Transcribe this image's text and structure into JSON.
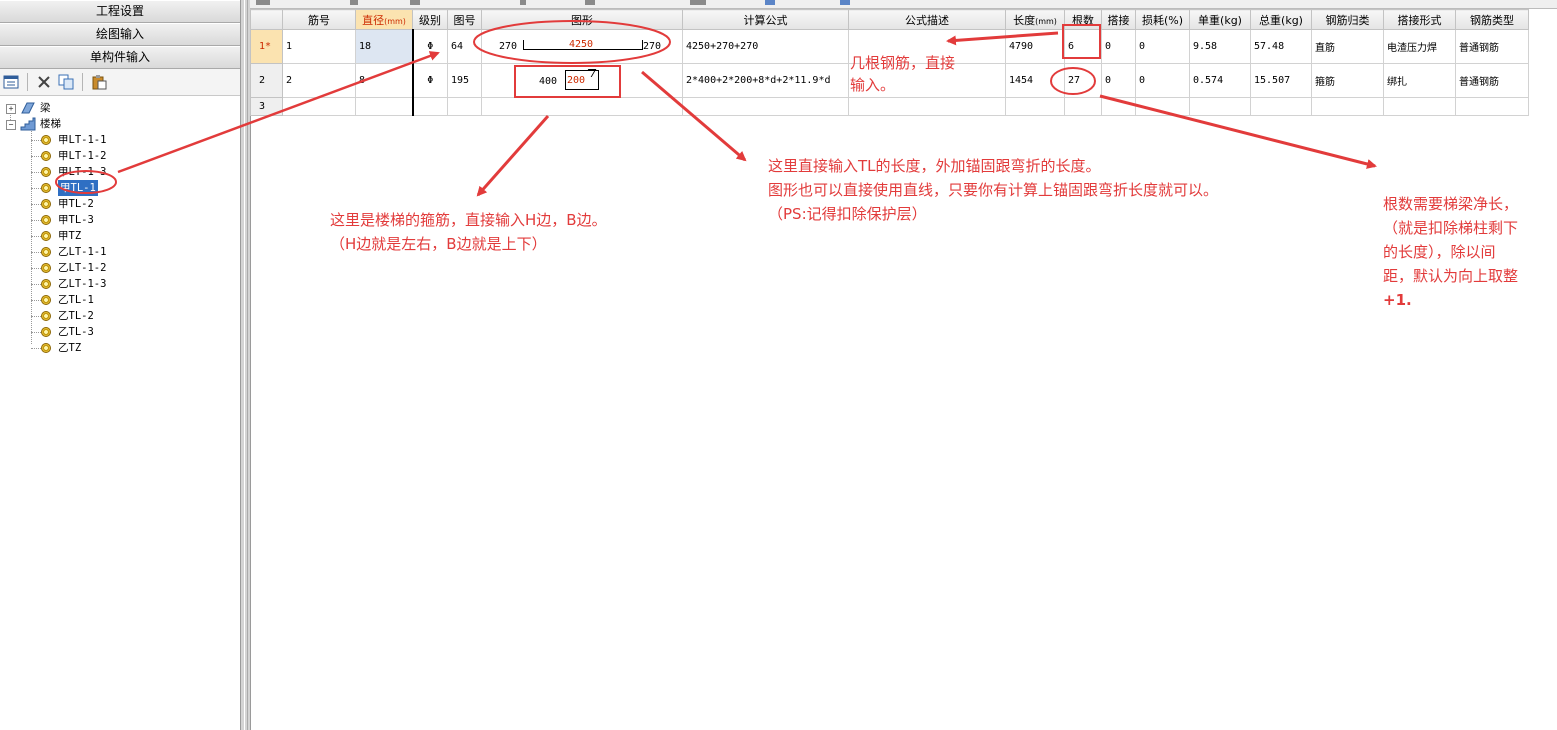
{
  "left_panel": {
    "nav_buttons": [
      "工程设置",
      "绘图输入",
      "单构件输入"
    ],
    "tree": {
      "groups": [
        {
          "label": "梁",
          "expander": "+"
        },
        {
          "label": "楼梯",
          "expander": "−"
        }
      ],
      "items": [
        "甲LT-1-1",
        "甲LT-1-2",
        "甲LT-1-3",
        "甲TL-1",
        "甲TL-2",
        "甲TL-3",
        "甲TZ",
        "乙LT-1-1",
        "乙LT-1-2",
        "乙LT-1-3",
        "乙TL-1",
        "乙TL-2",
        "乙TL-3",
        "乙TZ"
      ],
      "selected": "甲TL-1"
    }
  },
  "grid": {
    "headers": {
      "row": "",
      "jinhao": "筋号",
      "zhijing": "直径",
      "zhijing_unit": "(mm)",
      "jibie": "级别",
      "tuhao": "图号",
      "tuxing": "图形",
      "jisuan": "计算公式",
      "miaoshu": "公式描述",
      "changdu": "长度",
      "changdu_unit": "(mm)",
      "genshu": "根数",
      "dajie": "搭接",
      "sunhao": "损耗(%)",
      "danzhong": "单重(kg)",
      "zongzhong": "总重(kg)",
      "guilei": "钢筋归类",
      "dajiexingshi": "搭接形式",
      "leixing": "钢筋类型"
    },
    "rows": [
      {
        "row": "1*",
        "jinhao": "1",
        "zhijing": "18",
        "jibie": "Φ",
        "tuhao": "64",
        "shape_left": "270",
        "shape_mid": "4250",
        "shape_right": "270",
        "jisuan": "4250+270+270",
        "miaoshu": "",
        "changdu": "4790",
        "genshu": "6",
        "dajie": "0",
        "sunhao": "0",
        "danzhong": "9.58",
        "zongzhong": "57.48",
        "guilei": "直筋",
        "dajiexingshi": "电渣压力焊",
        "leixing": "普通钢筋"
      },
      {
        "row": "2",
        "jinhao": "2",
        "zhijing": "8",
        "jibie": "Φ",
        "tuhao": "195",
        "shape_left": "400",
        "shape_mid": "200",
        "jisuan": "2*400+2*200+8*d+2*11.9*d",
        "miaoshu": "",
        "changdu": "1454",
        "genshu": "27",
        "dajie": "0",
        "sunhao": "0",
        "danzhong": "0.574",
        "zongzhong": "15.507",
        "guilei": "箍筋",
        "dajiexingshi": "绑扎",
        "leixing": "普通钢筋"
      },
      {
        "row": "3"
      }
    ]
  },
  "annotations": {
    "count_note": [
      "几根钢筋，直接",
      "输入。"
    ],
    "stirrup_note": [
      "这里是楼梯的箍筋，直接输入H边，B边。",
      "（H边就是左右，B边就是上下）"
    ],
    "length_note": [
      "这里直接输入TL的长度，外加锚固跟弯折的长度。",
      "图形也可以直接使用直线，只要你有计算上锚固跟弯折长度就可以。",
      "（PS:记得扣除保护层）"
    ],
    "root_note": [
      "根数需要梯梁净长，",
      "（就是扣除梯柱剩下",
      "的长度），除以间",
      "距，默认为向上取整",
      "+1."
    ],
    "color": "#e23b3b"
  }
}
